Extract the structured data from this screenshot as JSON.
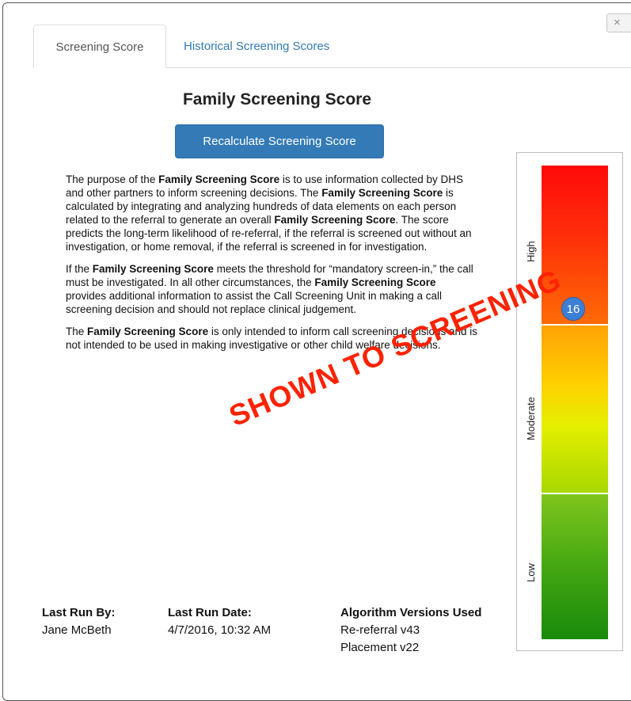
{
  "dialog": {
    "close_label": "×"
  },
  "tabs": [
    {
      "label": "Screening Score",
      "active": true
    },
    {
      "label": "Historical Screening Scores",
      "active": false
    }
  ],
  "title": "Family Screening Score",
  "recalculate_label": "Recalculate Screening Score",
  "description": {
    "p1": [
      {
        "t": "The purpose of the ",
        "b": false
      },
      {
        "t": "Family Screening Score",
        "b": true
      },
      {
        "t": " is to use information collected by DHS and other partners to inform screening decisions. The ",
        "b": false
      },
      {
        "t": "Family Screening Score",
        "b": true
      },
      {
        "t": " is calculated by integrating and analyzing hundreds of data elements on each person related to the referral to generate an overall ",
        "b": false
      },
      {
        "t": "Family Screening Score",
        "b": true
      },
      {
        "t": ".  The score predicts the long-term likelihood of re-referral, if the referral is screened out without an investigation, or home removal, if the referral is screened in for investigation.",
        "b": false
      }
    ],
    "p2": [
      {
        "t": "If the ",
        "b": false
      },
      {
        "t": "Family Screening Score",
        "b": true
      },
      {
        "t": " meets the threshold for “mandatory screen-in,” the call must be investigated. In all other circumstances, the ",
        "b": false
      },
      {
        "t": "Family Screening Score",
        "b": true
      },
      {
        "t": " provides additional information to assist the Call Screening Unit in making a call screening decision and should not replace clinical judgement.",
        "b": false
      }
    ],
    "p3": [
      {
        "t": "The ",
        "b": false
      },
      {
        "t": "Family Screening Score",
        "b": true
      },
      {
        "t": " is only intended to inform call screening decisions and is not intended to be used in making investigative or other child welfare decisions.",
        "b": false
      }
    ]
  },
  "gauge": {
    "labels": {
      "high": "High",
      "moderate": "Moderate",
      "low": "Low"
    },
    "score": "16",
    "colors": {
      "high": "#ff1a0a",
      "moderate": "#ffd000",
      "low": "#2f9a10",
      "marker": "#3d7fd4"
    }
  },
  "watermark": "SHOWN TO SCREENING",
  "footer": {
    "last_run_by_label": "Last Run By:",
    "last_run_by": "Jane McBeth",
    "last_run_date_label": "Last Run Date:",
    "last_run_date": "4/7/2016, 10:32 AM",
    "algorithm_label": "Algorithm Versions Used",
    "algorithms": [
      "Re-referral v43",
      "Placement v22"
    ]
  }
}
